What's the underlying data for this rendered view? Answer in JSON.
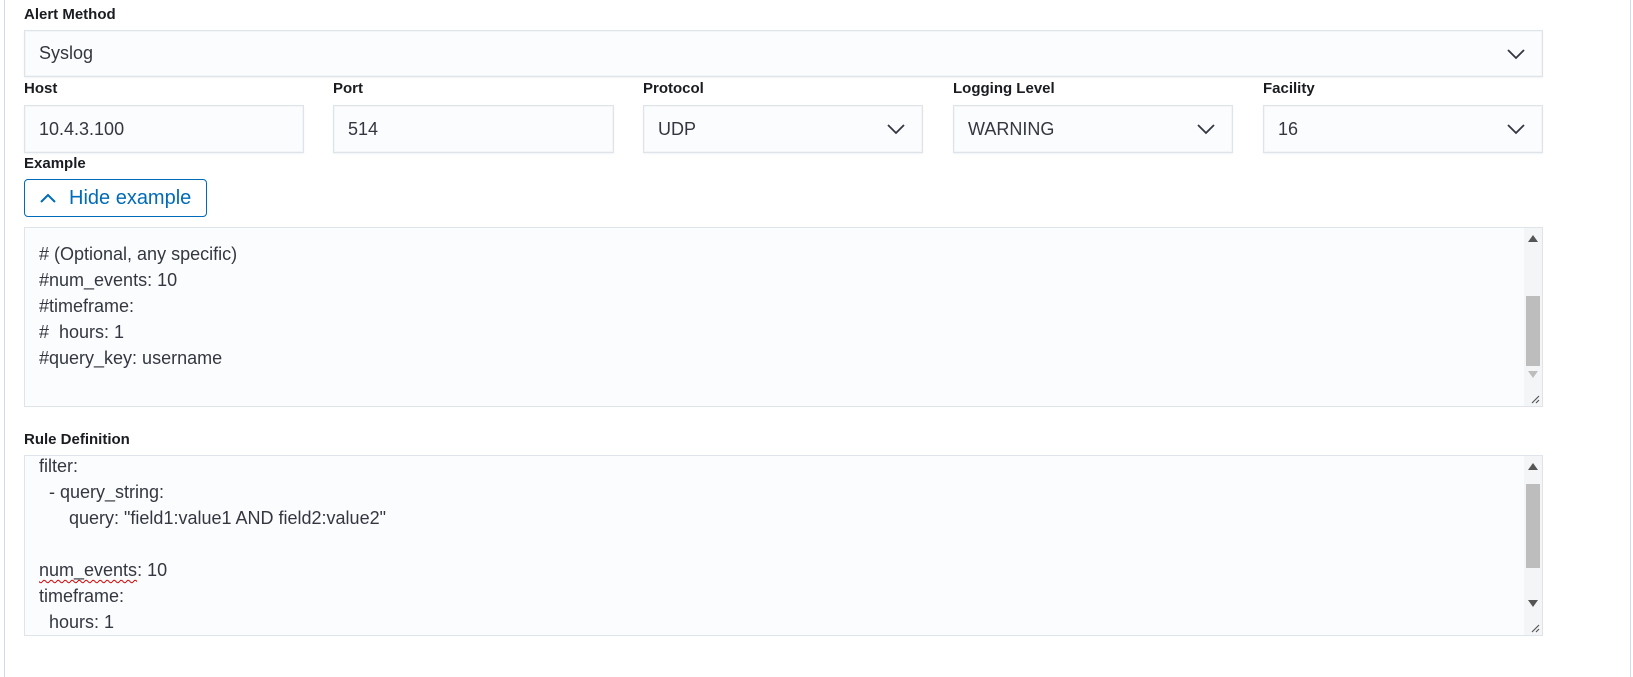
{
  "alert_method": {
    "label": "Alert Method",
    "value": "Syslog"
  },
  "host": {
    "label": "Host",
    "value": "10.4.3.100"
  },
  "port": {
    "label": "Port",
    "value": "514"
  },
  "protocol": {
    "label": "Protocol",
    "value": "UDP"
  },
  "logging_level": {
    "label": "Logging Level",
    "value": "WARNING"
  },
  "facility": {
    "label": "Facility",
    "value": "16"
  },
  "example": {
    "label": "Example",
    "toggle_label": "Hide example",
    "lines": [
      "# (Optional, any specific)",
      "#num_events: 10",
      "#timeframe:",
      "#  hours: 1",
      "#query_key: username"
    ]
  },
  "rule_definition": {
    "label": "Rule Definition",
    "lines": [
      "filter:",
      "  - query_string:",
      "      query: \"field1:value1 AND field2:value2\"",
      "",
      "num_events: 10",
      "timeframe:",
      "  hours: 1"
    ],
    "misspelled_word": "num_events",
    "line5_rest": ": 10"
  },
  "colors": {
    "accent": "#006bb8",
    "field_bg": "#fbfcfd",
    "border": "#dfe3ea",
    "spellcheck": "#d40000"
  },
  "icons": {
    "select_chevron": "chevron-down-icon",
    "toggle_chevron": "chevron-up-icon",
    "resize_grip": "resize-grip-icon"
  }
}
